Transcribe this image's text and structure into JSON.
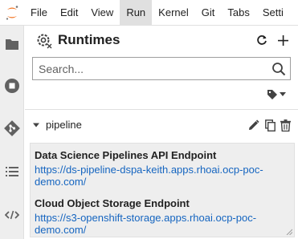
{
  "menu": {
    "items": [
      {
        "label": "File"
      },
      {
        "label": "Edit"
      },
      {
        "label": "View"
      },
      {
        "label": "Run"
      },
      {
        "label": "Kernel"
      },
      {
        "label": "Git"
      },
      {
        "label": "Tabs"
      },
      {
        "label": "Setti"
      }
    ],
    "active": "Run"
  },
  "leftbar": {
    "icons": [
      "folder-icon",
      "running-stop-icon",
      "git-icon",
      "table-of-contents-icon",
      "code-snippets-icon"
    ]
  },
  "panel": {
    "title": "Runtimes",
    "search_placeholder": "Search...",
    "runtime": {
      "name": "pipeline",
      "fields": [
        {
          "label": "Data Science Pipelines API Endpoint",
          "url": "https://ds-pipeline-dspa-keith.apps.rhoai.ocp-poc-demo.com/"
        },
        {
          "label": "Cloud Object Storage Endpoint",
          "url": "https://s3-openshift-storage.apps.rhoai.ocp-poc-demo.com/"
        }
      ]
    }
  },
  "colors": {
    "jupyter_orange": "#f37726",
    "link_blue": "#1565c0",
    "icon_gray": "#616161"
  }
}
